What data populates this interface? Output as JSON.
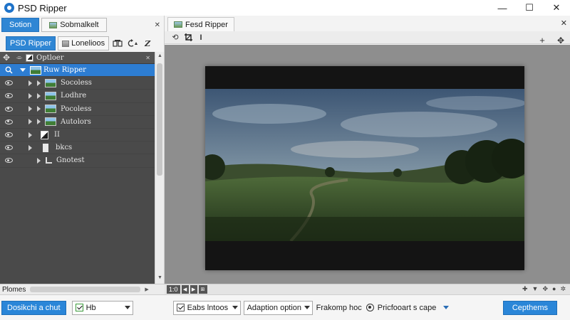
{
  "app": {
    "title": "PSD Ripper"
  },
  "window_controls": {
    "minimize": "—",
    "maximize": "☐",
    "close": "✕"
  },
  "left_panel": {
    "tabs": [
      {
        "label": "Sotion",
        "active": true
      },
      {
        "label": "Sobmalkelt",
        "active": false
      }
    ],
    "tabs_close": "✕",
    "subtabs": [
      {
        "label": "PSD Ripper",
        "active": true
      },
      {
        "label": "Lonelioos",
        "active": false
      }
    ],
    "layers_header": "Optloer",
    "layers": [
      {
        "label": "Ruw Ripper",
        "selected": true,
        "thumb": "landscape"
      },
      {
        "label": "Socoless",
        "selected": false,
        "thumb": "landscape"
      },
      {
        "label": "Lodhre",
        "selected": false,
        "thumb": "landscape"
      },
      {
        "label": "Pocoless",
        "selected": false,
        "thumb": "landscape"
      },
      {
        "label": "Autolors",
        "selected": false,
        "thumb": "landscape"
      },
      {
        "label": "II",
        "selected": false,
        "thumb": "half"
      },
      {
        "label": "bkcs",
        "selected": false,
        "thumb": "doc"
      },
      {
        "label": "Gnotest",
        "selected": false,
        "thumb": "none"
      }
    ],
    "footer_label": "Plomes"
  },
  "document": {
    "tab_label": "Fesd Ripper",
    "tab_close": "✕"
  },
  "zoom": {
    "value": "1:0"
  },
  "bottom_bar": {
    "primary_button": "Dosikchi a chut",
    "hb_select": "Hb",
    "edits_select": "Eabs lntoos",
    "adoption_select": "Adaption option",
    "frakomp_label": "Frakomp hoc",
    "profile_select": "Pricfooart s cape",
    "confirm_button": "Cepthems"
  },
  "colors": {
    "accent": "#2f86d4",
    "layers_bg": "#4a4a4a",
    "viewport_bg": "#8e8e8e"
  }
}
